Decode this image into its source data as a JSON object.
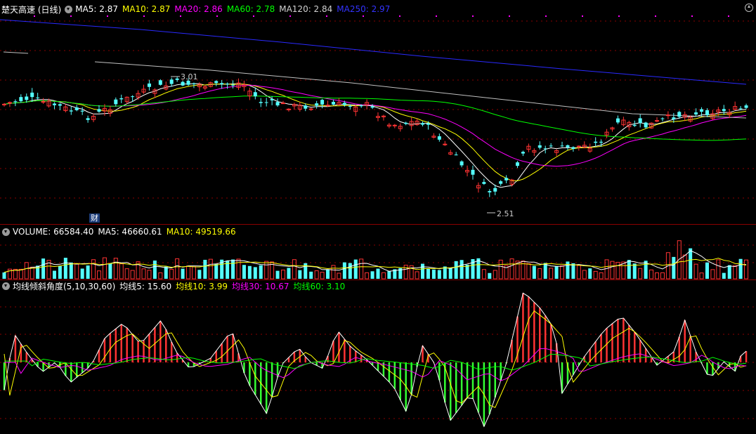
{
  "price_header": {
    "title": "楚天高速 (日线)",
    "ma5": "MA5: 2.87",
    "ma10": "MA10: 2.87",
    "ma20": "MA20: 2.86",
    "ma60": "MA60: 2.78",
    "ma120": "MA120: 2.84",
    "ma250": "MA250: 2.97"
  },
  "price_annotations": {
    "high": "3.01",
    "low": "2.51",
    "finance_tag": "财"
  },
  "volume_header": {
    "volume": "VOLUME: 66584.40",
    "ma5": "MA5: 46660.61",
    "ma10": "MA10: 49519.66"
  },
  "indicator_header": {
    "name": "均线倾斜角度(5,10,30,60)",
    "l5": "均线5: 15.60",
    "l10": "均线10: 3.99",
    "l30": "均线30: 10.67",
    "l60": "均线60: 3.10"
  },
  "colors": {
    "up": "#ff3333",
    "down": "#54ffff",
    "ma5": "#ffffff",
    "ma10": "#ffff00",
    "ma20": "#ff00ff",
    "ma60": "#00ff00",
    "ma120": "#c0c0c0",
    "ma250": "#2a2aff",
    "grid": "#8b0000"
  },
  "icons": [
    "collapse-circle-icon",
    "maximize-icon"
  ]
}
